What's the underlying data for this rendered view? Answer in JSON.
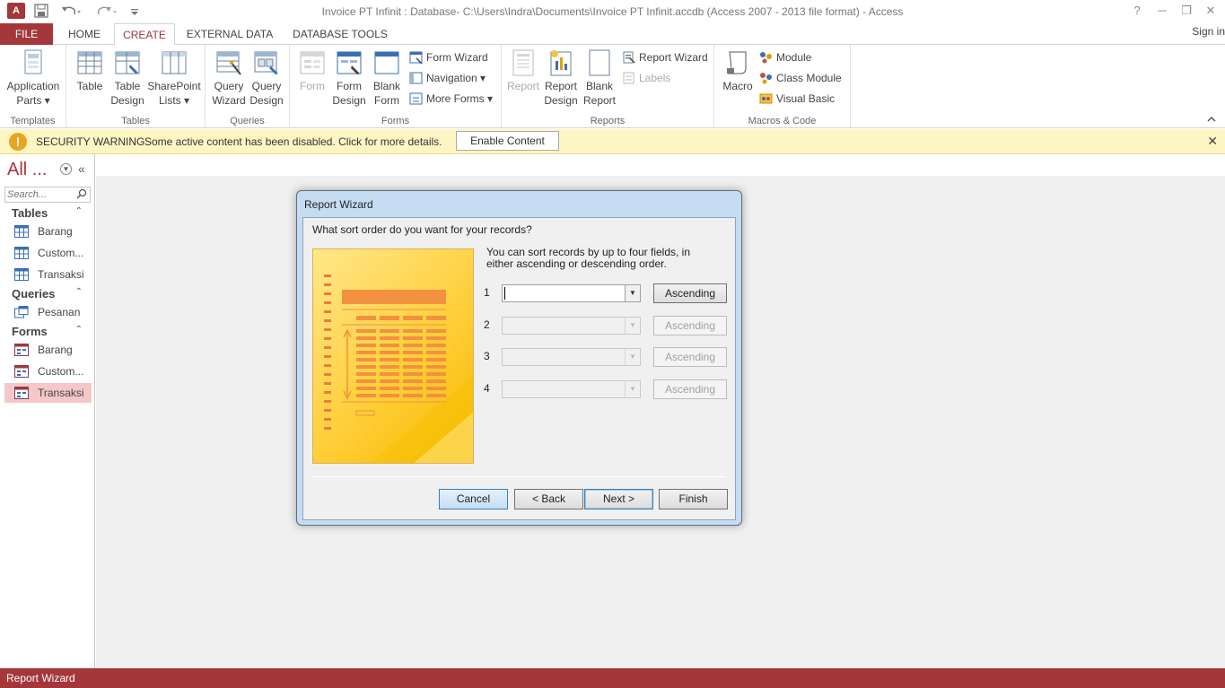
{
  "title_bar": {
    "app_icon": "A",
    "title": "Invoice PT Infinit : Database- C:\\Users\\Indra\\Documents\\Invoice PT Infinit.accdb (Access 2007 - 2013 file format) - Access",
    "help": "?",
    "window_controls": [
      "─",
      "❐",
      "✕"
    ]
  },
  "tabs": {
    "file": "FILE",
    "items": [
      "HOME",
      "CREATE",
      "EXTERNAL DATA",
      "DATABASE TOOLS"
    ],
    "active": "CREATE",
    "signin": "Sign in"
  },
  "ribbon": {
    "templates": {
      "label": "Templates",
      "application_parts": "Application Parts ▾"
    },
    "tables": {
      "label": "Tables",
      "table": "Table",
      "table_design": "Table Design",
      "sharepoint_lists": "SharePoint Lists ▾"
    },
    "queries": {
      "label": "Queries",
      "query_wizard": "Query Wizard",
      "query_design": "Query Design"
    },
    "forms": {
      "label": "Forms",
      "form": "Form",
      "form_design": "Form Design",
      "blank_form": "Blank Form",
      "form_wizard": "Form Wizard",
      "navigation": "Navigation ▾",
      "more_forms": "More Forms ▾"
    },
    "reports": {
      "label": "Reports",
      "report": "Report",
      "report_design": "Report Design",
      "blank_report": "Blank Report",
      "report_wizard": "Report Wizard",
      "labels": "Labels"
    },
    "macros": {
      "label": "Macros & Code",
      "macro": "Macro",
      "module": "Module",
      "class_module": "Class Module",
      "visual_basic": "Visual Basic"
    }
  },
  "security_bar": {
    "title": "SECURITY WARNING",
    "message": "Some active content has been disabled. Click for more details.",
    "enable_button": "Enable Content",
    "close": "✕"
  },
  "nav_pane": {
    "title": "All ...",
    "search_placeholder": "Search...",
    "sections": [
      {
        "label": "Tables",
        "items": [
          "Barang",
          "Custom...",
          "Transaksi"
        ]
      },
      {
        "label": "Queries",
        "items": [
          "Pesanan"
        ]
      },
      {
        "label": "Forms",
        "items": [
          "Barang",
          "Custom...",
          "Transaksi"
        ]
      }
    ],
    "selected": "Forms/Transaksi"
  },
  "dialog": {
    "title": "Report Wizard",
    "question": "What sort order do you want for your records?",
    "help_text": "You can sort records by up to four fields, in either ascending or descending order.",
    "sort_rows": [
      {
        "num": "1",
        "value": "",
        "button": "Ascending",
        "enabled": true
      },
      {
        "num": "2",
        "value": "",
        "button": "Ascending",
        "enabled": false
      },
      {
        "num": "3",
        "value": "",
        "button": "Ascending",
        "enabled": false
      },
      {
        "num": "4",
        "value": "",
        "button": "Ascending",
        "enabled": false
      }
    ],
    "buttons": {
      "cancel": "Cancel",
      "back": "< Back",
      "next": "Next >",
      "finish": "Finish"
    }
  },
  "status_bar": {
    "text": "Report Wizard"
  },
  "colors": {
    "accent": "#a4373a",
    "warning_bar": "#fdf6c3",
    "dialog_frame": "#c5dcf3"
  }
}
